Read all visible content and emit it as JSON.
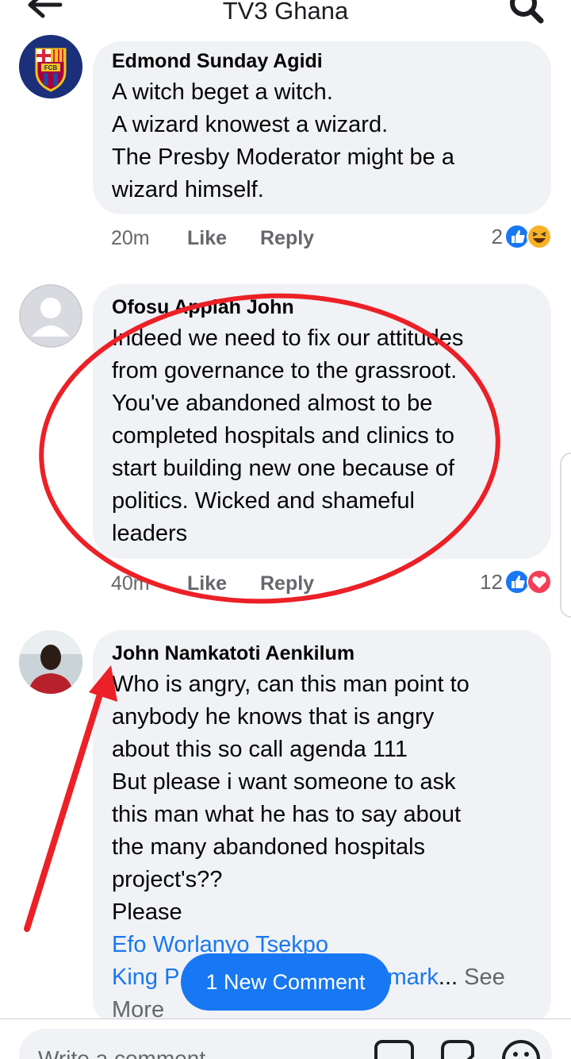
{
  "header": {
    "title": "TV3 Ghana"
  },
  "comments": [
    {
      "author": "Edmond Sunday Agidi",
      "avatar_badge": "FCB",
      "lines": [
        "A witch beget a witch.",
        "A wizard knowest a wizard.",
        "The Presby Moderator might be a",
        "wizard himself."
      ],
      "time": "20m",
      "like": "Like",
      "reply": "Reply",
      "reaction_count": "2"
    },
    {
      "author": "Ofosu Appiah John",
      "lines": [
        "Indeed we need to fix our attitudes",
        "from governance to the grassroot.",
        "You've abandoned almost to be",
        "completed hospitals and clinics to",
        "start building new one because of",
        "politics. Wicked and shameful",
        "leaders"
      ],
      "time": "40m",
      "like": "Like",
      "reply": "Reply",
      "reaction_count": "12"
    },
    {
      "author": "John Namkatoti Aenkilum",
      "lines": [
        "Who is angry, can this man point to",
        "anybody he knows that is angry",
        "about this so call agenda 111",
        "But please i want someone to ask",
        "this man what he has to say about",
        "the many abandoned hospitals",
        "project's??",
        "Please"
      ],
      "mention_1": "Efo Worlanyo Tsekpo",
      "mention_2_start": "King P",
      "mention_2_end": "mark",
      "ellipsis": "...",
      "see_more_a": "See",
      "see_more_b": "More"
    }
  ],
  "new_comment_pill": "1 New Comment",
  "composer": {
    "placeholder": "Write a comment..."
  },
  "colors": {
    "accent": "#1877f2",
    "annotation_red": "#ec2027",
    "bubble": "#f0f2f5"
  }
}
